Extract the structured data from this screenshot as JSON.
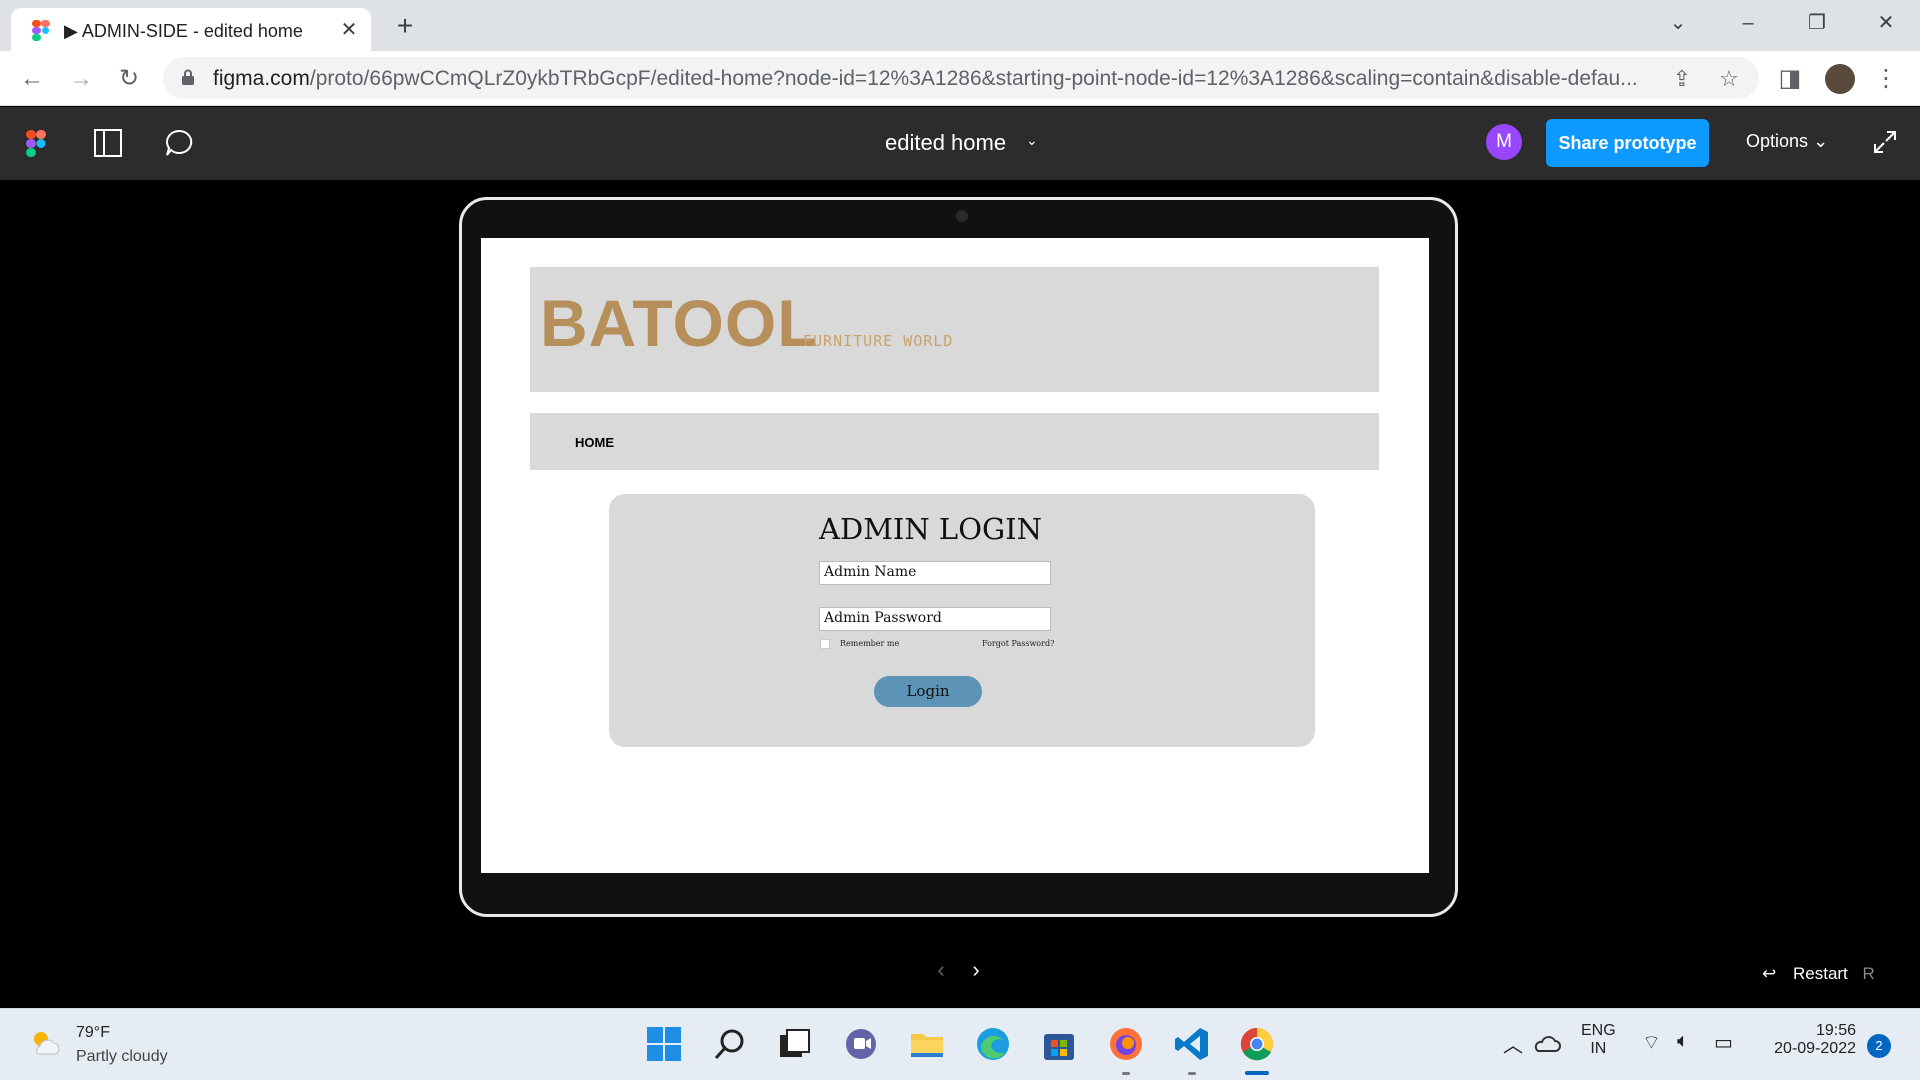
{
  "browser": {
    "tab_title": "▶ ADMIN-SIDE - edited home",
    "url_host": "figma.com",
    "url_path": "/proto/66pwCCmQLrZ0ykbTRbGcpF/edited-home?node-id=12%3A1286&starting-point-node-id=12%3A1286&scaling=contain&disable-defau..."
  },
  "figma": {
    "file_title": "edited home",
    "avatar_initial": "M",
    "share_label": "Share prototype",
    "options_label": "Options",
    "restart_label": "Restart",
    "restart_key": "R"
  },
  "prototype": {
    "brand": "BATOOL",
    "brand_subtitle": "FURNITURE WORLD",
    "nav_home": "HOME",
    "login_title": "ADMIN LOGIN",
    "admin_name_placeholder": "Admin Name",
    "admin_password_placeholder": "Admin Password",
    "remember_label": "Remember me",
    "forgot_label": "Forgot Password?",
    "login_button": "Login"
  },
  "taskbar": {
    "temperature": "79°F",
    "weather": "Partly cloudy",
    "lang_top": "ENG",
    "lang_bottom": "IN",
    "time": "19:56",
    "date": "20-09-2022",
    "notification_count": "2"
  },
  "colors": {
    "brand_gold": "#b68f5a",
    "figma_blue": "#0d99ff",
    "login_button": "#5e93b8",
    "panel_grey": "#d9d9d9"
  }
}
